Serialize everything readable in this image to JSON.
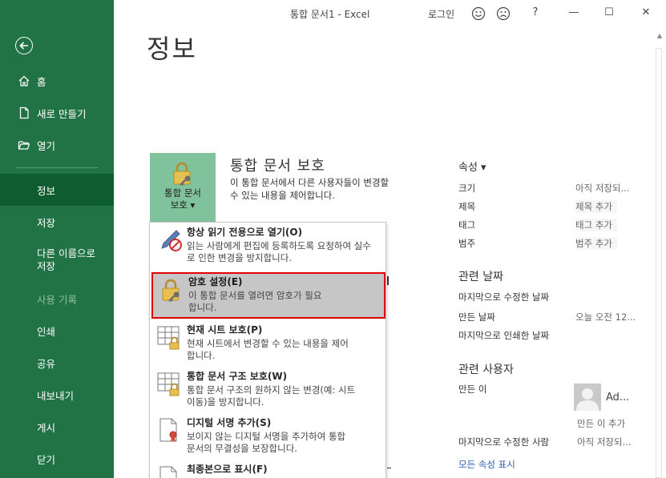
{
  "window": {
    "title": "통합 문서1  -  Excel",
    "login": "로그인",
    "help": "?",
    "minimize": "—",
    "maximize": "☐",
    "close": "✕"
  },
  "sidebar": {
    "items": [
      {
        "label": "홈",
        "icon": "home-icon"
      },
      {
        "label": "새로 만들기",
        "icon": "new-document-icon"
      },
      {
        "label": "열기",
        "icon": "open-folder-icon"
      },
      {
        "label": "정보",
        "active": true
      },
      {
        "label": "저장"
      },
      {
        "label": "다른 이름으로\n저장"
      },
      {
        "label": "사용 기록",
        "disabled": true
      },
      {
        "label": "인쇄"
      },
      {
        "label": "공유"
      },
      {
        "label": "내보내기"
      },
      {
        "label": "게시"
      },
      {
        "label": "닫기"
      }
    ]
  },
  "main": {
    "page_title": "정보",
    "protect": {
      "button_label_line1": "통합 문서",
      "button_label_line2": "보호 ▾",
      "title": "통합 문서 보호",
      "description": "이 통합 문서에서 다른 사용자들이 변경할 수 있는 내용을 제어합니다."
    }
  },
  "menu": {
    "items": [
      {
        "title": "항상 읽기 전용으로 열기(O)",
        "desc": "읽는 사람에게 편집에 등록하도록 요청하여 실수로 인한 변경을 방지합니다.",
        "icon": "pencil-prohibited-icon"
      },
      {
        "title": "암호 설정(E)",
        "desc": "이 통합 문서를 열려면 암호가 필요합니다.",
        "icon": "lock-key-icon",
        "selected": true
      },
      {
        "title": "현재 시트 보호(P)",
        "desc": "현재 시트에서 변경할 수 있는 내용을 제어합니다.",
        "icon": "sheet-lock-icon"
      },
      {
        "title": "통합 문서 구조 보호(W)",
        "desc": "통합 문서 구조의 원하지 않는 변경(예: 시트 이동)을 방지합니다.",
        "icon": "workbook-lock-icon"
      },
      {
        "title": "디지털 서명 추가(S)",
        "desc": "보이지 않는 디지털 서명을 추가하여 통합 문서의 무결성을 보장합니다.",
        "icon": "signature-ribbon-icon"
      },
      {
        "title": "최종본으로 표시(F)",
        "desc": "",
        "icon": "final-document-icon"
      }
    ]
  },
  "properties": {
    "header": "속성 ▾",
    "rows": [
      {
        "label": "크기",
        "value": "아직 저장되..."
      },
      {
        "label": "제목",
        "value": "제목 추가"
      },
      {
        "label": "태그",
        "value": "태그 추가"
      },
      {
        "label": "범주",
        "value": "범주 추가"
      }
    ],
    "dates_title": "관련 날짜",
    "dates": [
      {
        "label": "마지막으로 수정한 날짜",
        "value": ""
      },
      {
        "label": "만든 날짜",
        "value": "오늘 오전 12..."
      },
      {
        "label": "마지막으로 인쇄한 날짜",
        "value": ""
      }
    ],
    "people_title": "관련 사용자",
    "author_label": "만든 이",
    "author_name": "Ad...",
    "add_author": "만든 이 추가",
    "last_modified_by_label": "마지막으로 수정한 사람",
    "last_modified_by_value": "아직 저장되...",
    "all_props_link": "모든 속성 표시"
  },
  "colors": {
    "sidebar": "#217346",
    "sidebar_active": "#0e5c2f",
    "protect_button": "#7fc29b",
    "selected_item": "#c6c6c6",
    "highlight_border": "#e00000",
    "link": "#2a5fb0"
  }
}
